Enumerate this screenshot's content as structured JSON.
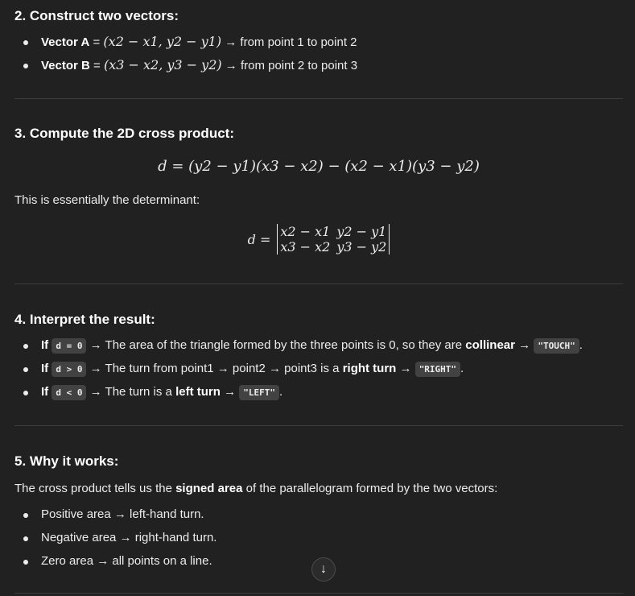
{
  "section2": {
    "heading": "2. Construct two vectors:",
    "items": [
      {
        "label": "Vector A",
        "eq": " = ",
        "math": "(x2 − x1, y2 − y1)",
        "rest": " → from point 1 to point 2"
      },
      {
        "label": "Vector B",
        "eq": " = ",
        "math": "(x3 − x2, y3 − y2)",
        "rest": " → from point 2 to point 3"
      }
    ]
  },
  "section3": {
    "heading": "3. Compute the 2D cross product:",
    "formula": "d = (y2 − y1)(x3 − x2) − (x2 − x1)(y3 − y2)",
    "text": "This is essentially the determinant:",
    "det_lhs": "d =",
    "det_r1c1": "x2 − x1",
    "det_r1c2": "y2 − y1",
    "det_r2c1": "x3 − x2",
    "det_r2c2": "y3 − y2"
  },
  "section4": {
    "heading": "4. Interpret the result:",
    "items": [
      {
        "if": "If",
        "code": "d = 0",
        "text": " → The area of the triangle formed by the three points is 0, so they are ",
        "bold": "collinear",
        "arrow": " → ",
        "result": "\"TOUCH\"",
        "tail": "."
      },
      {
        "if": "If",
        "code": "d > 0",
        "text": " → The turn from point1 → point2 → point3 is a ",
        "bold": "right turn",
        "arrow": " → ",
        "result": "\"RIGHT\"",
        "tail": "."
      },
      {
        "if": "If",
        "code": "d < 0",
        "text": " → The turn is a ",
        "bold": "left turn",
        "arrow": " → ",
        "result": "\"LEFT\"",
        "tail": "."
      }
    ]
  },
  "section5": {
    "heading": "5. Why it works:",
    "text_pre": "The cross product tells us the ",
    "text_bold": "signed area",
    "text_post": " of the parallelogram formed by the two vectors:",
    "items": [
      "Positive area → left-hand turn.",
      "Negative area → right-hand turn.",
      "Zero area → all points on a line."
    ]
  },
  "scroll_button": {
    "icon": "↓"
  }
}
